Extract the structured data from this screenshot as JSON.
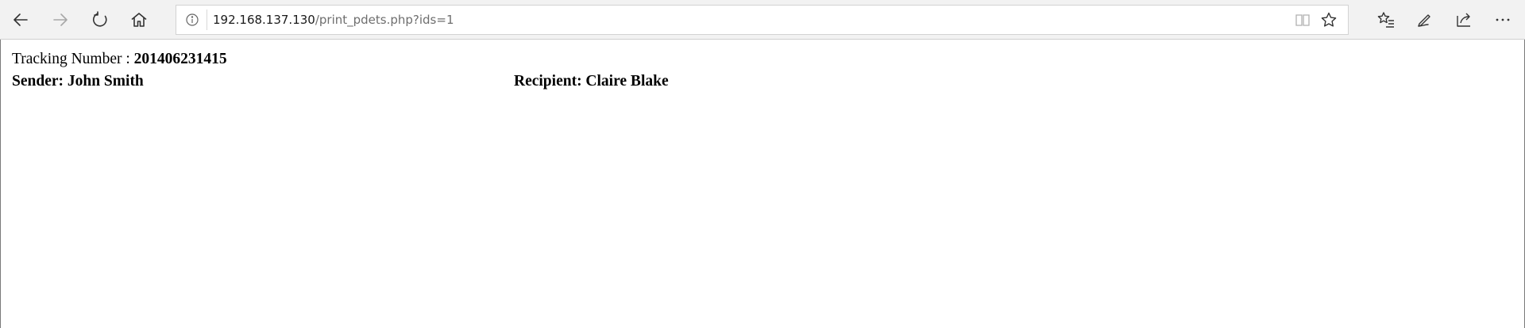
{
  "browser": {
    "nav": {
      "back_icon": "arrow-left-icon",
      "forward_icon": "arrow-right-icon",
      "refresh_icon": "refresh-icon",
      "home_icon": "home-icon"
    },
    "address_bar": {
      "host": "192.168.137.130",
      "path": "/print_pdets.php?ids=1",
      "info_icon": "info-icon",
      "reading_view_icon": "book-icon",
      "favorite_icon": "star-icon"
    },
    "actions": {
      "favorites_icon": "favorites-list-icon",
      "notes_icon": "pen-icon",
      "share_icon": "share-icon",
      "more_icon": "more-icon"
    }
  },
  "page": {
    "tracking_label": "Tracking Number : ",
    "tracking_number": "201406231415",
    "sender": "Sender: John Smith",
    "recipient": "Recipient: Claire Blake"
  }
}
